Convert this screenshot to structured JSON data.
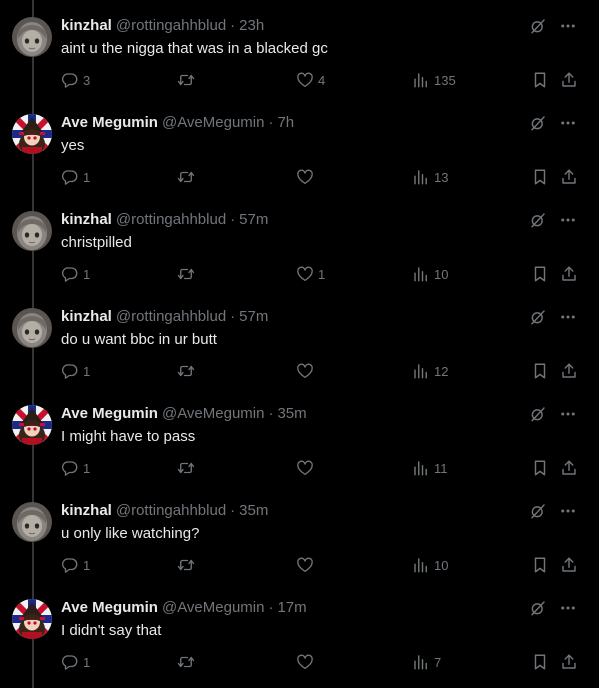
{
  "colors": {
    "background": "#000000",
    "text": "#e7e9ea",
    "muted": "#71767b",
    "thread_line": "#333639"
  },
  "icons": {
    "grok": "grok-icon",
    "more": "more-dots-icon",
    "reply": "reply-icon",
    "retweet": "retweet-icon",
    "like": "like-icon",
    "views": "views-icon",
    "bookmark": "bookmark-icon",
    "share": "share-icon"
  },
  "posts": [
    {
      "name": "kinzhal",
      "handle": "@rottingahhblud",
      "sep": "·",
      "time": "23h",
      "text": "aint u the nigga that was in a blacked gc",
      "replies": "3",
      "retweets": "",
      "likes": "4",
      "views": "135",
      "avatar": "kinzhal"
    },
    {
      "name": "Ave Megumin",
      "handle": "@AveMegumin",
      "sep": "·",
      "time": "7h",
      "text": "yes",
      "replies": "1",
      "retweets": "",
      "likes": "",
      "views": "13",
      "avatar": "megumin"
    },
    {
      "name": "kinzhal",
      "handle": "@rottingahhblud",
      "sep": "·",
      "time": "57m",
      "text": "christpilled",
      "replies": "1",
      "retweets": "",
      "likes": "1",
      "views": "10",
      "avatar": "kinzhal"
    },
    {
      "name": "kinzhal",
      "handle": "@rottingahhblud",
      "sep": "·",
      "time": "57m",
      "text": "do u want bbc in ur butt",
      "replies": "1",
      "retweets": "",
      "likes": "",
      "views": "12",
      "avatar": "kinzhal"
    },
    {
      "name": "Ave Megumin",
      "handle": "@AveMegumin",
      "sep": "·",
      "time": "35m",
      "text": "I might have to pass",
      "replies": "1",
      "retweets": "",
      "likes": "",
      "views": "11",
      "avatar": "megumin"
    },
    {
      "name": "kinzhal",
      "handle": "@rottingahhblud",
      "sep": "·",
      "time": "35m",
      "text": "u only like watching?",
      "replies": "1",
      "retweets": "",
      "likes": "",
      "views": "10",
      "avatar": "kinzhal"
    },
    {
      "name": "Ave Megumin",
      "handle": "@AveMegumin",
      "sep": "·",
      "time": "17m",
      "text": "I didn't say that",
      "replies": "1",
      "retweets": "",
      "likes": "",
      "views": "7",
      "avatar": "megumin"
    }
  ]
}
